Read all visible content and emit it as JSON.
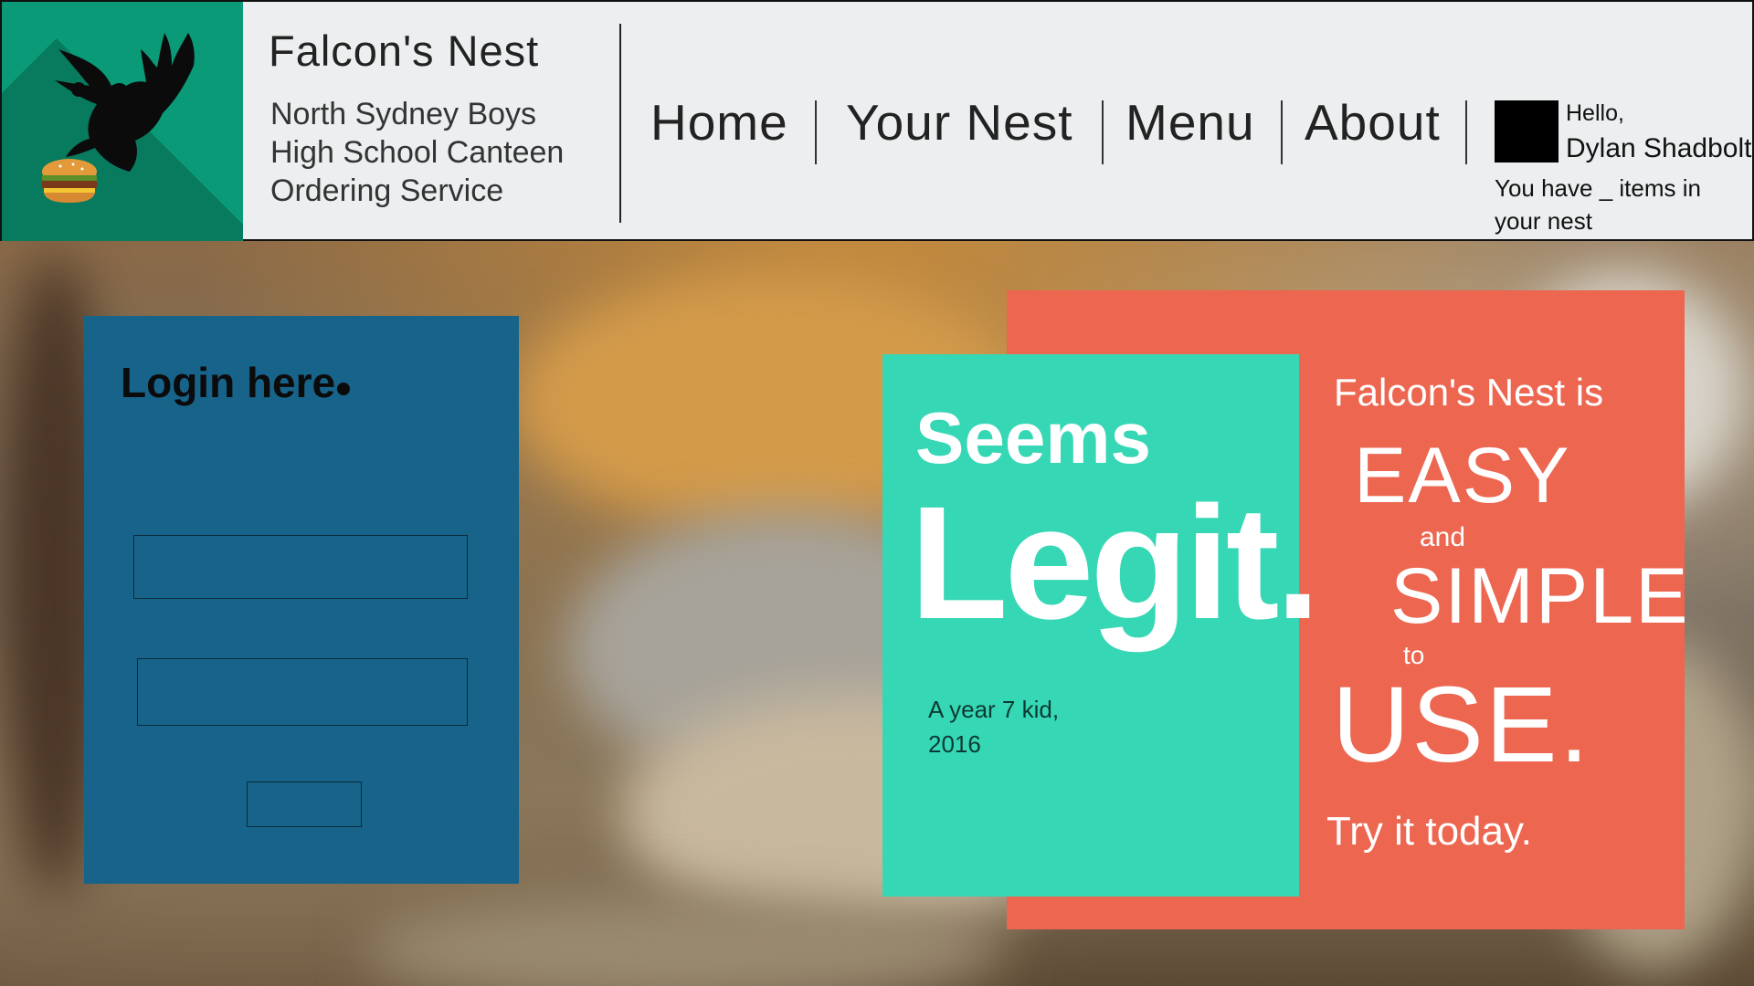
{
  "header": {
    "title": "Falcon's Nest",
    "subtitle_lines": [
      "North Sydney Boys",
      "High School Canteen",
      "Ordering Service"
    ]
  },
  "nav": {
    "items": [
      {
        "label": "Home"
      },
      {
        "label": "Your Nest"
      },
      {
        "label": "Menu"
      },
      {
        "label": "About"
      }
    ]
  },
  "user": {
    "greeting": "Hello,",
    "name": "Dylan Shadbolt",
    "nest_message": "You have _ items in your nest"
  },
  "login": {
    "title": "Login here",
    "username_value": "",
    "password_value": "",
    "submit_label": ""
  },
  "quote": {
    "line1": "Seems",
    "line2": "Legit.",
    "attribution_line1": "A year 7 kid,",
    "attribution_line2": "2016"
  },
  "promo": {
    "intro": "Falcon's Nest is",
    "easy": "EASY",
    "and": "and",
    "simple": "SIMPLE",
    "to": "to",
    "use": "USE.",
    "cta": "Try it today."
  },
  "colors": {
    "logo_bg": "#0a9a77",
    "header_bg": "#eceeef",
    "login_panel": "#176389",
    "promo_bg": "#ec6650",
    "quote_bg": "#36d7b5"
  },
  "icons": {
    "logo": "falcon-with-burger-icon",
    "avatar": "user-avatar"
  }
}
